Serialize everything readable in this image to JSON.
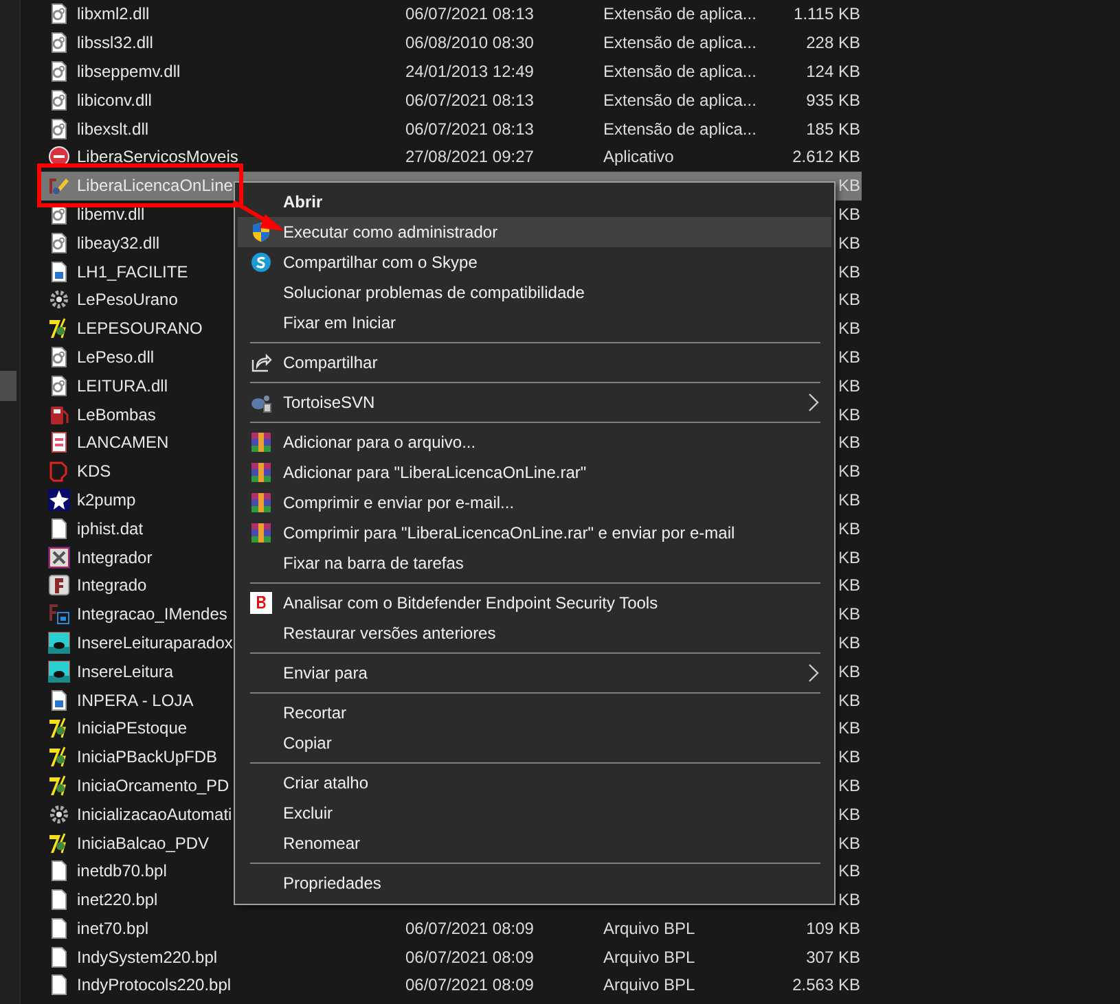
{
  "files": [
    {
      "name": "libxml2.dll",
      "kind": "dll",
      "date": "06/07/2021 08:13",
      "type": "Extensão de aplica...",
      "size": "1.115 KB",
      "selected": false
    },
    {
      "name": "libssl32.dll",
      "kind": "dll",
      "date": "06/08/2010 08:30",
      "type": "Extensão de aplica...",
      "size": "228 KB",
      "selected": false
    },
    {
      "name": "libseppemv.dll",
      "kind": "dll",
      "date": "24/01/2013 12:49",
      "type": "Extensão de aplica...",
      "size": "124 KB",
      "selected": false
    },
    {
      "name": "libiconv.dll",
      "kind": "dll",
      "date": "06/07/2021 08:13",
      "type": "Extensão de aplica...",
      "size": "935 KB",
      "selected": false
    },
    {
      "name": "libexslt.dll",
      "kind": "dll",
      "date": "06/07/2021 08:13",
      "type": "Extensão de aplica...",
      "size": "185 KB",
      "selected": false
    },
    {
      "name": "LiberaServicosMoveis",
      "kind": "dx",
      "date": "27/08/2021 09:27",
      "type": "Aplicativo",
      "size": "2.612 KB",
      "selected": false
    },
    {
      "name": "LiberaLicencaOnLine",
      "kind": "pencil",
      "size": "KB",
      "selected": true
    },
    {
      "name": "libemv.dll",
      "kind": "dll",
      "size": "KB",
      "selected": false
    },
    {
      "name": "libeay32.dll",
      "kind": "dll",
      "size": "KB",
      "selected": false
    },
    {
      "name": "LH1_FACILITE",
      "kind": "image",
      "size": "KB",
      "selected": false
    },
    {
      "name": "LePesoUrano",
      "kind": "gear",
      "size": "KB",
      "selected": false
    },
    {
      "name": "LEPESOURANO",
      "kind": "bolt",
      "size": "KB",
      "selected": false
    },
    {
      "name": "LePeso.dll",
      "kind": "dll",
      "size": "KB",
      "selected": false
    },
    {
      "name": "LEITURA.dll",
      "kind": "dll",
      "size": "KB",
      "selected": false
    },
    {
      "name": "LeBombas",
      "kind": "pump",
      "size": "KB",
      "selected": false
    },
    {
      "name": "LANCAMEN",
      "kind": "list",
      "size": "KB",
      "selected": false
    },
    {
      "name": "KDS",
      "kind": "kds",
      "size": "KB",
      "selected": false
    },
    {
      "name": "k2pump",
      "kind": "star",
      "size": "KB",
      "selected": false
    },
    {
      "name": "iphist.dat",
      "kind": "blank",
      "size": "KB",
      "selected": false
    },
    {
      "name": "Integrador",
      "kind": "blueapp",
      "size": "KB",
      "selected": false
    },
    {
      "name": "Integrado",
      "kind": "fapp",
      "size": "KB",
      "selected": false
    },
    {
      "name": "Integracao_IMendes",
      "kind": "fblue",
      "size": "KB",
      "selected": false
    },
    {
      "name": "InsereLeituraparadox",
      "kind": "scene",
      "size": "KB",
      "selected": false
    },
    {
      "name": "InsereLeitura",
      "kind": "scene",
      "size": "KB",
      "selected": false
    },
    {
      "name": "INPERA - LOJA",
      "kind": "image",
      "size": "KB",
      "selected": false
    },
    {
      "name": "IniciaPEstoque",
      "kind": "bolt",
      "size": "KB",
      "selected": false
    },
    {
      "name": "IniciaPBackUpFDB",
      "kind": "bolt",
      "size": "KB",
      "selected": false
    },
    {
      "name": "IniciaOrcamento_PD",
      "kind": "bolt",
      "size": "KB",
      "selected": false
    },
    {
      "name": "InicializacaoAutomati",
      "kind": "gear",
      "size": "KB",
      "selected": false
    },
    {
      "name": "IniciaBalcao_PDV",
      "kind": "bolt",
      "size": "KB",
      "selected": false
    },
    {
      "name": "inetdb70.bpl",
      "kind": "blank",
      "size": "KB",
      "selected": false
    },
    {
      "name": "inet220.bpl",
      "kind": "blank",
      "size": "KB",
      "selected": false
    },
    {
      "name": "inet70.bpl",
      "kind": "blank",
      "date": "06/07/2021 08:09",
      "type": "Arquivo BPL",
      "size": "109 KB",
      "selected": false
    },
    {
      "name": "IndySystem220.bpl",
      "kind": "blank",
      "date": "06/07/2021 08:09",
      "type": "Arquivo BPL",
      "size": "307 KB",
      "selected": false
    },
    {
      "name": "IndyProtocols220.bpl",
      "kind": "blank",
      "date": "06/07/2021 08:09",
      "type": "Arquivo BPL",
      "size": "2.563 KB",
      "selected": false
    }
  ],
  "context_menu": {
    "items": [
      {
        "kind": "plain",
        "label": "Abrir",
        "default": true,
        "submenu": false,
        "selected": false
      },
      {
        "kind": "shield",
        "label": "Executar como administrador",
        "default": false,
        "submenu": false,
        "selected": true
      },
      {
        "kind": "skype",
        "label": "Compartilhar com o Skype",
        "default": false,
        "submenu": false,
        "selected": false
      },
      {
        "kind": "plain",
        "label": "Solucionar problemas de compatibilidade",
        "default": false,
        "submenu": false,
        "selected": false
      },
      {
        "kind": "plain",
        "label": "Fixar em Iniciar",
        "default": false,
        "submenu": false,
        "selected": false
      },
      {
        "kind": "separator"
      },
      {
        "kind": "share",
        "label": "Compartilhar",
        "default": false,
        "submenu": false,
        "selected": false
      },
      {
        "kind": "separator"
      },
      {
        "kind": "turtle",
        "label": "TortoiseSVN",
        "default": false,
        "submenu": true,
        "selected": false
      },
      {
        "kind": "separator"
      },
      {
        "kind": "archive",
        "label": "Adicionar para o arquivo...",
        "default": false,
        "submenu": false,
        "selected": false
      },
      {
        "kind": "archive",
        "label": "Adicionar para \"LiberaLicencaOnLine.rar\"",
        "default": false,
        "submenu": false,
        "selected": false
      },
      {
        "kind": "archive",
        "label": "Comprimir e enviar por e-mail...",
        "default": false,
        "submenu": false,
        "selected": false
      },
      {
        "kind": "archive",
        "label": "Comprimir para \"LiberaLicencaOnLine.rar\" e enviar por e-mail",
        "default": false,
        "submenu": false,
        "selected": false
      },
      {
        "kind": "plain",
        "label": "Fixar na barra de tarefas",
        "default": false,
        "submenu": false,
        "selected": false
      },
      {
        "kind": "separator"
      },
      {
        "kind": "bitdefender",
        "label": "Analisar com o Bitdefender Endpoint Security Tools",
        "default": false,
        "submenu": false,
        "selected": false
      },
      {
        "kind": "plain",
        "label": "Restaurar versões anteriores",
        "default": false,
        "submenu": false,
        "selected": false
      },
      {
        "kind": "separator"
      },
      {
        "kind": "plain",
        "label": "Enviar para",
        "default": false,
        "submenu": true,
        "selected": false
      },
      {
        "kind": "separator"
      },
      {
        "kind": "plain",
        "label": "Recortar",
        "default": false,
        "submenu": false,
        "selected": false
      },
      {
        "kind": "plain",
        "label": "Copiar",
        "default": false,
        "submenu": false,
        "selected": false
      },
      {
        "kind": "separator"
      },
      {
        "kind": "plain",
        "label": "Criar atalho",
        "default": false,
        "submenu": false,
        "selected": false
      },
      {
        "kind": "plain",
        "label": "Excluir",
        "default": false,
        "submenu": false,
        "selected": false
      },
      {
        "kind": "plain",
        "label": "Renomear",
        "default": false,
        "submenu": false,
        "selected": false
      },
      {
        "kind": "separator"
      },
      {
        "kind": "plain",
        "label": "Propriedades",
        "default": false,
        "submenu": false,
        "selected": false
      }
    ]
  }
}
